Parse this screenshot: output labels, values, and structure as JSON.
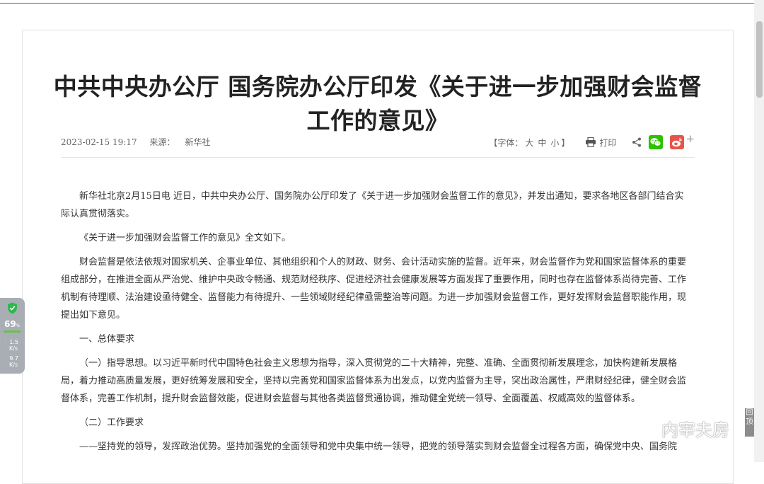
{
  "article": {
    "title": "中共中央办公厅 国务院办公厅印发《关于进一步加强财会监督工作的意见》",
    "date": "2023-02-15 19:17",
    "source_label": "来源：",
    "source": "新华社",
    "font_label_open": "【字体：",
    "font_large": "大",
    "font_medium": "中",
    "font_small": "小",
    "font_label_close": "】",
    "print_label": "打印",
    "share_plus": "+",
    "paragraphs": [
      "新华社北京2月15日电 近日，中共中央办公厅、国务院办公厅印发了《关于进一步加强财会监督工作的意见》，并发出通知，要求各地区各部门结合实际认真贯彻落实。",
      "《关于进一步加强财会监督工作的意见》全文如下。",
      "财会监督是依法依规对国家机关、企事业单位、其他组织和个人的财政、财务、会计活动实施的监督。近年来，财会监督作为党和国家监督体系的重要组成部分，在推进全面从严治党、维护中央政令畅通、规范财经秩序、促进经济社会健康发展等方面发挥了重要作用，同时也存在监督体系尚待完善、工作机制有待理顺、法治建设亟待健全、监督能力有待提升、一些领域财经纪律亟需整治等问题。为进一步加强财会监督工作，更好发挥财会监督职能作用，现提出如下意见。",
      "一、总体要求",
      "（一）指导思想。以习近平新时代中国特色社会主义思想为指导，深入贯彻党的二十大精神，完整、准确、全面贯彻新发展理念，加快构建新发展格局，着力推动高质量发展，更好统筹发展和安全，坚持以完善党和国家监督体系为出发点，以党内监督为主导，突出政治属性，严肃财经纪律，健全财会监督体系，完善工作机制，提升财会监督效能，促进财会监督与其他各类监督贯通协调，推动健全党统一领导、全面覆盖、权威高效的监督体系。",
      "（二）工作要求",
      "——坚持党的领导，发挥政治优势。坚持加强党的全面领导和党中央集中统一领导，把党的领导落实到财会监督全过程各方面，确保党中央、国务院"
    ]
  },
  "speed_widget": {
    "score": "69",
    "score_unit": "%",
    "up_value": "1.5",
    "up_unit": "K/s",
    "down_value": "9.7",
    "down_unit": "K/s"
  },
  "back_to_top": "回顶",
  "watermark": "内宰夫房",
  "colors": {
    "wechat": "#2dc100",
    "weibo": "#e6554a",
    "topline": "#4a6b8f"
  }
}
